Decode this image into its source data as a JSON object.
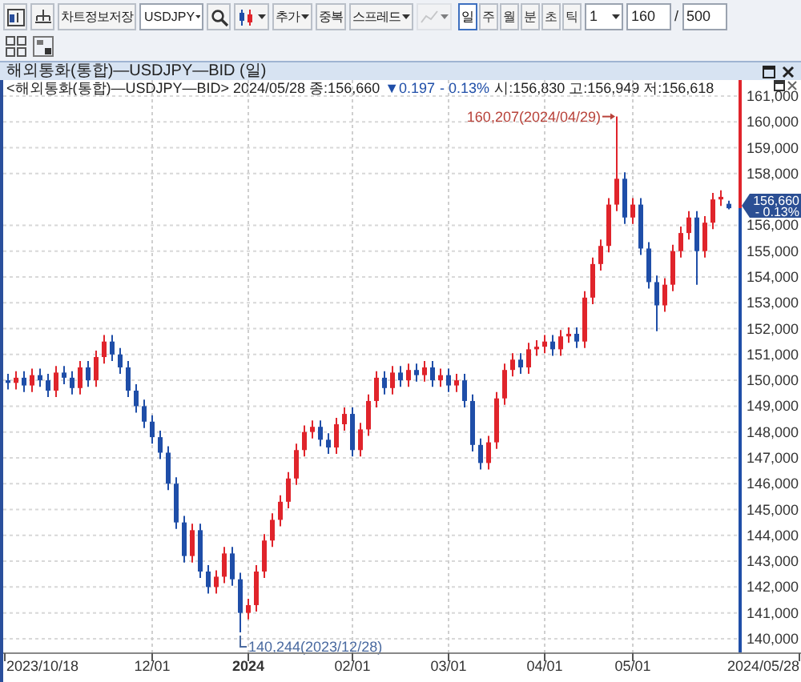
{
  "toolbar": [
    {
      "kind": "icon"
    },
    {
      "kind": "icon"
    },
    {
      "kind": "button",
      "label": "차트정보저장"
    },
    {
      "kind": "combo",
      "label": "USDJPY"
    },
    {
      "kind": "icon"
    },
    {
      "kind": "dropicon"
    },
    {
      "kind": "dropdown",
      "label": "추가"
    },
    {
      "kind": "button",
      "label": "중복"
    },
    {
      "kind": "dropdown",
      "label": "스프레드"
    },
    {
      "kind": "dropicon",
      "disabled": true
    }
  ],
  "periods": [
    {
      "label": "일",
      "selected": true
    },
    {
      "label": "주",
      "selected": false
    },
    {
      "label": "월",
      "selected": false
    },
    {
      "label": "분",
      "selected": false
    },
    {
      "label": "초",
      "selected": false
    },
    {
      "label": "틱",
      "selected": false
    }
  ],
  "interval": "1",
  "count": "160",
  "separator": "/",
  "max_count": "500",
  "panel": {
    "title": "해외통화(통합)—USDJPY—BID (일)",
    "info": {
      "symbol": "<해외통화(통합)—USDJPY—BID> 2024/05/28 종:156,660",
      "change": "▼0.197",
      "percent": "- 0.13%",
      "ohlc": "시:156,830 고:156,949 저:156,618"
    },
    "price_tag": {
      "price": "156,660",
      "percent": "- 0.13%"
    },
    "range_start": "2023/10/18",
    "range_end": "2024/05/28",
    "chart_data": {
      "type": "candlestick",
      "grid": true,
      "categories": [
        null,
        null,
        null,
        null,
        null,
        null,
        null,
        null,
        null,
        null,
        null,
        null,
        null,
        null,
        null,
        null,
        null,
        null,
        "12/01",
        null,
        null,
        null,
        null,
        null,
        null,
        null,
        null,
        null,
        null,
        null,
        "2024",
        null,
        null,
        null,
        null,
        null,
        null,
        null,
        null,
        null,
        null,
        null,
        null,
        "02/01",
        null,
        null,
        null,
        null,
        null,
        null,
        null,
        null,
        null,
        null,
        null,
        "03/01",
        null,
        null,
        null,
        null,
        null,
        null,
        null,
        null,
        null,
        null,
        null,
        "04/01",
        null,
        null,
        null,
        null,
        null,
        null,
        null,
        null,
        null,
        null,
        "05/01",
        null,
        null,
        null,
        null,
        null,
        null,
        null,
        null,
        null,
        null,
        null,
        null
      ],
      "ylim": [
        139440,
        161620
      ],
      "ohlc": [
        [
          150000,
          150250,
          149650,
          149900
        ],
        [
          149900,
          150350,
          149650,
          150100
        ],
        [
          150100,
          150350,
          149550,
          149800
        ],
        [
          149800,
          150450,
          149550,
          150200
        ],
        [
          150200,
          150450,
          149750,
          150000
        ],
        [
          150000,
          150250,
          149350,
          149600
        ],
        [
          149600,
          150550,
          149350,
          150300
        ],
        [
          150300,
          150550,
          149850,
          150100
        ],
        [
          150100,
          150350,
          149450,
          149700
        ],
        [
          149700,
          150750,
          149450,
          150500
        ],
        [
          150500,
          150750,
          149750,
          150000
        ],
        [
          150000,
          151150,
          149750,
          150900
        ],
        [
          150900,
          151750,
          150650,
          151500
        ],
        [
          151500,
          151750,
          150750,
          151000
        ],
        [
          151000,
          151250,
          150250,
          150500
        ],
        [
          150500,
          150750,
          149350,
          149600
        ],
        [
          149600,
          149850,
          148750,
          149000
        ],
        [
          149000,
          149250,
          148150,
          148400
        ],
        [
          148400,
          148650,
          147550,
          147800
        ],
        [
          147800,
          148050,
          146950,
          147200
        ],
        [
          147200,
          147450,
          145750,
          146000
        ],
        [
          146000,
          146250,
          144250,
          144500
        ],
        [
          144500,
          144750,
          142950,
          143200
        ],
        [
          143200,
          144450,
          142950,
          144200
        ],
        [
          144200,
          144450,
          142350,
          142600
        ],
        [
          142600,
          142850,
          141750,
          142000
        ],
        [
          142000,
          142650,
          141750,
          142400
        ],
        [
          142400,
          143550,
          142150,
          143300
        ],
        [
          143300,
          143550,
          142050,
          142300
        ],
        [
          142300,
          142550,
          140244,
          141000
        ],
        [
          141000,
          141550,
          140750,
          141300
        ],
        [
          141300,
          142850,
          141050,
          142600
        ],
        [
          142600,
          144050,
          142350,
          143800
        ],
        [
          143800,
          144850,
          143550,
          144600
        ],
        [
          144600,
          145550,
          144350,
          145300
        ],
        [
          145300,
          146450,
          145050,
          146200
        ],
        [
          146200,
          147550,
          145950,
          147300
        ],
        [
          147300,
          148250,
          147050,
          148000
        ],
        [
          148000,
          148450,
          147750,
          148200
        ],
        [
          148200,
          148450,
          147450,
          147700
        ],
        [
          147700,
          147950,
          147150,
          147400
        ],
        [
          147400,
          148550,
          147150,
          148300
        ],
        [
          148300,
          148950,
          148050,
          148700
        ],
        [
          148700,
          148950,
          147050,
          147300
        ],
        [
          147300,
          148350,
          147050,
          148100
        ],
        [
          148100,
          149450,
          147850,
          149200
        ],
        [
          149200,
          150350,
          148950,
          150100
        ],
        [
          150100,
          150350,
          149450,
          149700
        ],
        [
          149700,
          150550,
          149450,
          150300
        ],
        [
          150300,
          150550,
          149750,
          150000
        ],
        [
          150000,
          150650,
          149750,
          150400
        ],
        [
          150400,
          150650,
          149950,
          150200
        ],
        [
          150200,
          150750,
          149950,
          150500
        ],
        [
          150500,
          150750,
          149750,
          150000
        ],
        [
          150000,
          150450,
          149750,
          150200
        ],
        [
          150200,
          150450,
          149550,
          149800
        ],
        [
          149800,
          150250,
          149550,
          150000
        ],
        [
          150000,
          150250,
          148950,
          149200
        ],
        [
          149200,
          149450,
          147250,
          147500
        ],
        [
          147500,
          147750,
          146550,
          146800
        ],
        [
          146800,
          147850,
          146550,
          147600
        ],
        [
          147600,
          149550,
          147350,
          149300
        ],
        [
          149300,
          150650,
          149050,
          150400
        ],
        [
          150400,
          151050,
          150150,
          150800
        ],
        [
          150800,
          151050,
          150250,
          150500
        ],
        [
          150500,
          151450,
          150250,
          151200
        ],
        [
          151200,
          151550,
          150950,
          151300
        ],
        [
          151300,
          151750,
          151050,
          151500
        ],
        [
          151500,
          151750,
          150950,
          151200
        ],
        [
          151200,
          151950,
          150950,
          151700
        ],
        [
          151700,
          152050,
          151450,
          151800
        ],
        [
          151800,
          152050,
          151250,
          151500
        ],
        [
          151500,
          153450,
          151250,
          153200
        ],
        [
          153200,
          154750,
          152950,
          154500
        ],
        [
          154500,
          155450,
          154250,
          155200
        ],
        [
          155200,
          157050,
          154950,
          156800
        ],
        [
          156800,
          160207,
          156550,
          157800
        ],
        [
          157800,
          158050,
          156050,
          156300
        ],
        [
          156300,
          157050,
          156050,
          156800
        ],
        [
          156800,
          157050,
          154850,
          155100
        ],
        [
          155100,
          155350,
          153550,
          153800
        ],
        [
          153800,
          154050,
          151900,
          152900
        ],
        [
          152900,
          153950,
          152650,
          153700
        ],
        [
          153700,
          155250,
          153450,
          155000
        ],
        [
          155000,
          155950,
          154750,
          155700
        ],
        [
          155700,
          156550,
          155450,
          156300
        ],
        [
          156300,
          156550,
          153700,
          155000
        ],
        [
          155000,
          156350,
          154750,
          156100
        ],
        [
          156100,
          157250,
          155850,
          157000
        ],
        [
          157000,
          157350,
          156750,
          157100
        ],
        [
          156830,
          156949,
          156618,
          156660
        ]
      ],
      "yticks": [
        {
          "value": 140000,
          "label": "140,000"
        },
        {
          "value": 141000,
          "label": "141,000"
        },
        {
          "value": 142000,
          "label": "142,000"
        },
        {
          "value": 143000,
          "label": "143,000"
        },
        {
          "value": 144000,
          "label": "144,000"
        },
        {
          "value": 145000,
          "label": "145,000"
        },
        {
          "value": 146000,
          "label": "146,000"
        },
        {
          "value": 147000,
          "label": "147,000"
        },
        {
          "value": 148000,
          "label": "148,000"
        },
        {
          "value": 149000,
          "label": "149,000"
        },
        {
          "value": 150000,
          "label": "150,000"
        },
        {
          "value": 151000,
          "label": "151,000"
        },
        {
          "value": 152000,
          "label": "152,000"
        },
        {
          "value": 153000,
          "label": "153,000"
        },
        {
          "value": 154000,
          "label": "154,000"
        },
        {
          "value": 155000,
          "label": "155,000"
        },
        {
          "value": 156000,
          "label": "156,000"
        },
        {
          "value": 158000,
          "label": "158,000"
        },
        {
          "value": 159000,
          "label": "159,000"
        },
        {
          "value": 160000,
          "label": "160,000"
        },
        {
          "value": 161000,
          "label": "161,000"
        }
      ],
      "annotations": [
        "160,207(2024/04/29)",
        "140,244(2023/12/28)"
      ]
    }
  }
}
